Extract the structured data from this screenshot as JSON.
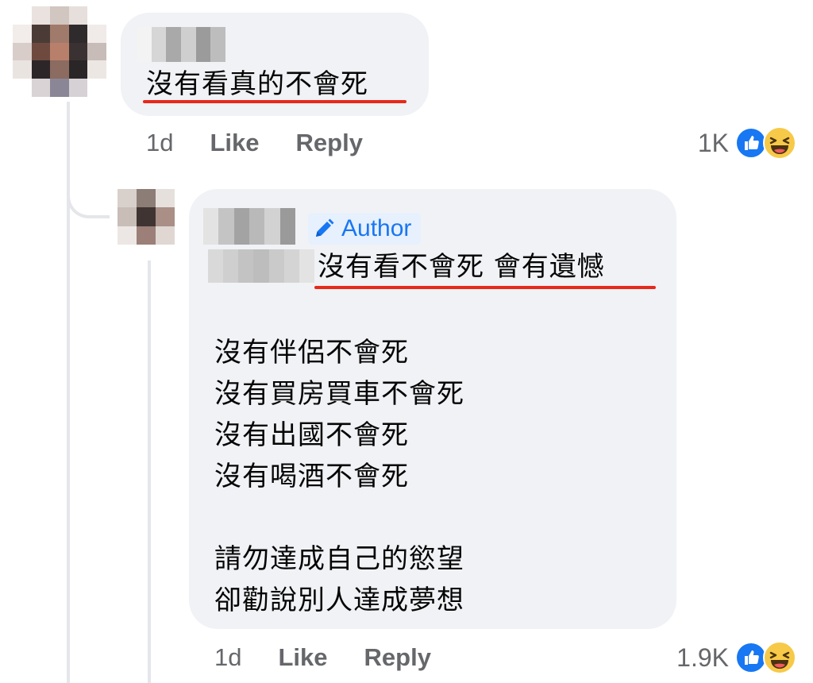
{
  "colors": {
    "bubble_bg": "#f0f2f5",
    "text": "#050505",
    "meta_text": "#65676b",
    "author_blue": "#1877f2",
    "underline_red": "#e8281b",
    "like_blue": "#1877f2",
    "haha_yellow": "#f7c948"
  },
  "main_comment": {
    "avatar": "pixelated-profile-photo",
    "name": "",
    "text": "沒有看真的不會死",
    "time": "1d",
    "like_label": "Like",
    "reply_label": "Reply",
    "reaction_count": "1K",
    "reaction_icons": [
      "like-icon",
      "haha-icon"
    ]
  },
  "reply_comment": {
    "avatar": "pixelated-profile-photo",
    "name": "",
    "author_badge": "Author",
    "badge_icon": "pen-icon",
    "mention": "",
    "first_line": "沒有看不會死  會有遺憾",
    "lines": [
      "沒有伴侶不會死",
      "沒有買房買車不會死",
      "沒有出國不會死",
      "沒有喝酒不會死",
      "",
      "請勿達成自己的慾望",
      "卻勸說別人達成夢想"
    ],
    "time": "1d",
    "like_label": "Like",
    "reply_label": "Reply",
    "reaction_count": "1.9K",
    "reaction_icons": [
      "like-icon",
      "haha-icon"
    ]
  }
}
